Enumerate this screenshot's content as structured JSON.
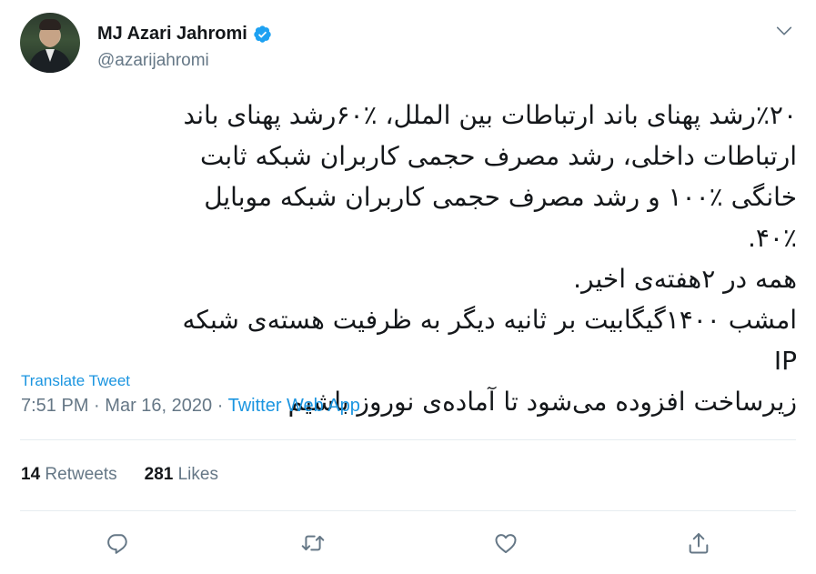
{
  "user": {
    "name": "MJ Azari Jahromi",
    "handle": "@azarijahromi",
    "verified": true
  },
  "tweet": {
    "text": "٪۲۰رشد پهنای باند ارتباطات بین الملل، ٪۶۰رشد پهنای باند\nارتباطات داخلی، رشد مصرف حجمی کاربران شبکه ثابت\nخانگی ٪۱۰۰ و رشد مصرف حجمی کاربران شبکه موبایل ٪۴۰.\nهمه در ۲هفته‌ی اخیر.\nامشب ۱۴۰۰گیگابیت بر ثانیه دیگر به ظرفیت هسته‌ی شبکه IP\nزیرساخت افزوده می‌شود تا آماده‌ی نوروز باشیم",
    "translate_label": "Translate Tweet",
    "time": "7:51 PM",
    "separator": "·",
    "date": "Mar 16, 2020",
    "source": "Twitter Web App"
  },
  "stats": {
    "retweets_count": "14",
    "retweets_label": "Retweets",
    "likes_count": "281",
    "likes_label": "Likes"
  },
  "colors": {
    "accent": "#1b95e0",
    "muted": "#657786",
    "text": "#14171a",
    "divider": "#e6ecf0"
  },
  "icons": {
    "reply": "reply-icon",
    "retweet": "retweet-icon",
    "like": "like-icon",
    "share": "share-icon",
    "caret": "chevron-down-icon",
    "verified": "verified-badge-icon"
  }
}
